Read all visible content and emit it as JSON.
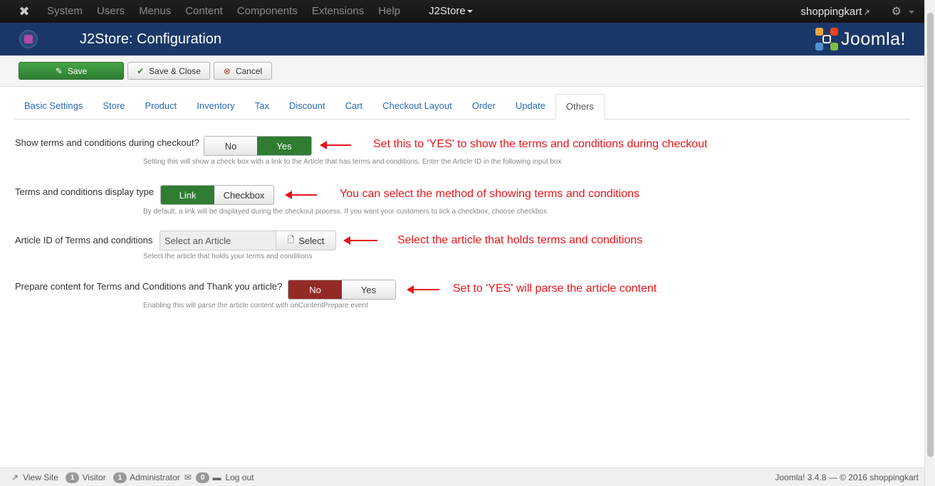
{
  "navbar": {
    "logo_icon": "joomla-icon",
    "menu": [
      "System",
      "Users",
      "Menus",
      "Content",
      "Components",
      "Extensions",
      "Help"
    ],
    "active_menu": "J2Store",
    "site_name": "shoppingkart",
    "settings_icon": "gear-icon"
  },
  "header": {
    "title": "J2Store: Configuration",
    "logo_text": "Joomla!"
  },
  "toolbar": {
    "save_label": "Save",
    "save_close_label": "Save & Close",
    "cancel_label": "Cancel"
  },
  "tabs": [
    "Basic Settings",
    "Store",
    "Product",
    "Inventory",
    "Tax",
    "Discount",
    "Cart",
    "Checkout Layout",
    "Order",
    "Update",
    "Others"
  ],
  "active_tab": "Others",
  "fields": {
    "show_terms": {
      "label": "Show terms and conditions during checkout?",
      "options": [
        "No",
        "Yes"
      ],
      "selected": "Yes",
      "description": "Setting this will show a check box with a link to the Article that has terms and conditions. Enter the Article ID in the following input box",
      "annotation": "Set this to 'YES' to show the terms and conditions during checkout"
    },
    "display_type": {
      "label": "Terms and conditions display type",
      "options": [
        "Link",
        "Checkbox"
      ],
      "selected": "Link",
      "description": "By default, a link will be displayed during the checkout process. If you want your customers to tick a checkbox, choose checkbox",
      "annotation": "You can select the method of showing terms and conditions"
    },
    "article_id": {
      "label": "Article ID of Terms and conditions",
      "placeholder": "Select an Article",
      "button_label": "Select",
      "description": "Select the article that holds your terms and conditions",
      "annotation": "Select the article that holds terms and conditions"
    },
    "prepare_content": {
      "label": "Prepare content for Terms and Conditions and Thank you article?",
      "options": [
        "No",
        "Yes"
      ],
      "selected": "No",
      "description": "Enabling this will parse the article content with onContentPrepare event",
      "annotation": "Set to 'YES' will parse the article content"
    }
  },
  "footer": {
    "view_site": "View Site",
    "visitor_count": "1",
    "visitor_label": "Visitor",
    "admin_count": "1",
    "admin_label": "Administrator",
    "messages_count": "0",
    "logout": "Log out",
    "copyright": "Joomla! 3.4.8 — © 2016 shoppingkart"
  },
  "colors": {
    "navbar": "#171717",
    "header": "#1a3867",
    "success": "#2f7d32",
    "danger": "#942a25",
    "link": "#2a69b8",
    "annotation": "#e8161b"
  }
}
